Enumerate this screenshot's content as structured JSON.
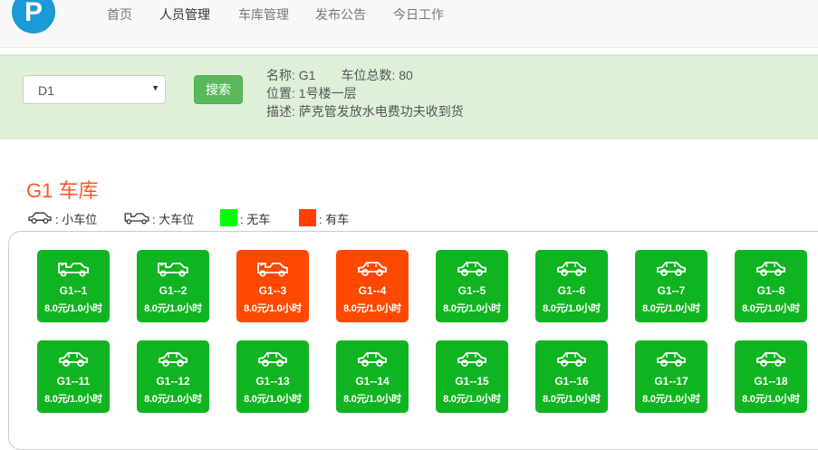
{
  "nav": {
    "logo": "P",
    "items": [
      "首页",
      "人员管理",
      "车库管理",
      "发布公告",
      "今日工作"
    ],
    "active_index": 1
  },
  "search": {
    "selected": "D1",
    "button": "搜索"
  },
  "info": {
    "name_label": "名称:",
    "name": "G1",
    "total_label": "车位总数:",
    "total": "80",
    "location_label": "位置:",
    "location": "1号楼一层",
    "desc_label": "描述:",
    "desc": "萨克管发放水电费功夫收到货"
  },
  "title": "G1 车库",
  "legend": {
    "small": ": 小车位",
    "large": ": 大车位",
    "free": ": 无车",
    "occupied": ": 有车",
    "free_color": "#10b420",
    "occupied_color": "#ff4800",
    "swatch_free": "#00ff00",
    "swatch_occupied": "#ff4000"
  },
  "slots": [
    {
      "name": "G1--1",
      "price": "8.0元/1.0小时",
      "size": "large",
      "status": "free"
    },
    {
      "name": "G1--2",
      "price": "8.0元/1.0小时",
      "size": "large",
      "status": "free"
    },
    {
      "name": "G1--3",
      "price": "8.0元/1.0小时",
      "size": "large",
      "status": "occupied"
    },
    {
      "name": "G1--4",
      "price": "8.0元/1.0小时",
      "size": "small",
      "status": "occupied"
    },
    {
      "name": "G1--5",
      "price": "8.0元/1.0小时",
      "size": "small",
      "status": "free"
    },
    {
      "name": "G1--6",
      "price": "8.0元/1.0小时",
      "size": "small",
      "status": "free"
    },
    {
      "name": "G1--7",
      "price": "8.0元/1.0小时",
      "size": "small",
      "status": "free"
    },
    {
      "name": "G1--8",
      "price": "8.0元/1.0小时",
      "size": "small",
      "status": "free"
    },
    {
      "name": "G1--11",
      "price": "8.0元/1.0小时",
      "size": "small",
      "status": "free"
    },
    {
      "name": "G1--12",
      "price": "8.0元/1.0小时",
      "size": "small",
      "status": "free"
    },
    {
      "name": "G1--13",
      "price": "8.0元/1.0小时",
      "size": "small",
      "status": "free"
    },
    {
      "name": "G1--14",
      "price": "8.0元/1.0小时",
      "size": "small",
      "status": "free"
    },
    {
      "name": "G1--15",
      "price": "8.0元/1.0小时",
      "size": "small",
      "status": "free"
    },
    {
      "name": "G1--16",
      "price": "8.0元/1.0小时",
      "size": "small",
      "status": "free"
    },
    {
      "name": "G1--17",
      "price": "8.0元/1.0小时",
      "size": "small",
      "status": "free"
    },
    {
      "name": "G1--18",
      "price": "8.0元/1.0小时",
      "size": "small",
      "status": "free"
    }
  ]
}
